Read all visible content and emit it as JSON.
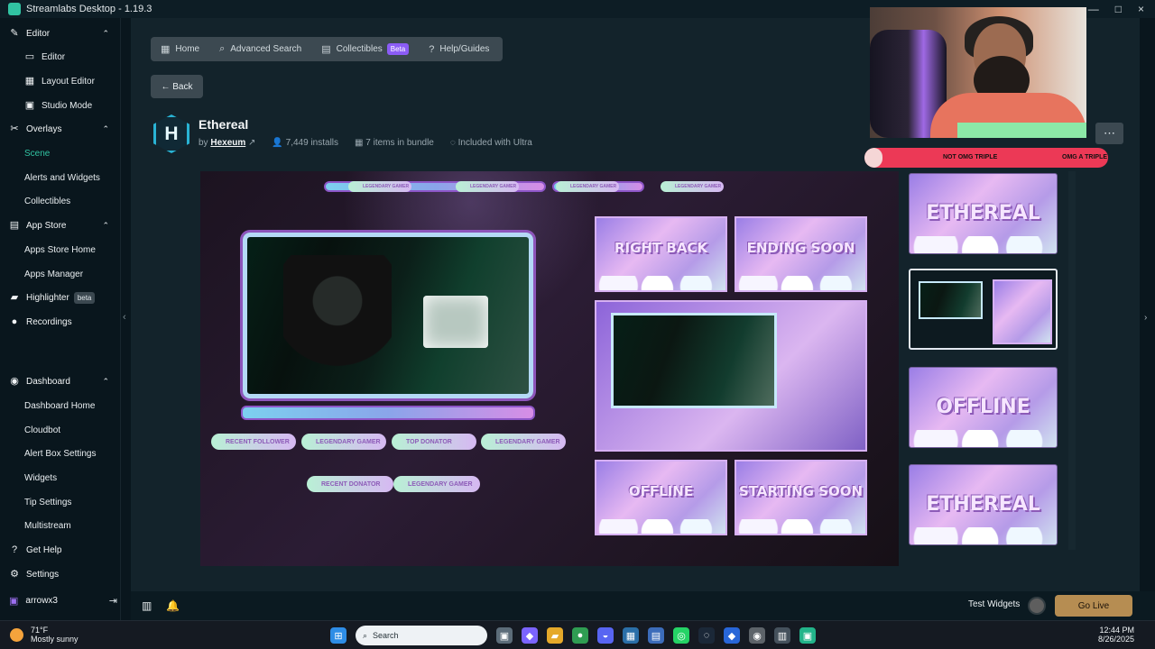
{
  "window": {
    "title": "Streamlabs Desktop - 1.19.3",
    "controls": [
      "—",
      "□",
      "×"
    ]
  },
  "sidebar": {
    "items": [
      {
        "label": "Editor",
        "icon": "pencil-icon",
        "type": "parent"
      },
      {
        "label": "Editor",
        "icon": "monitor-icon",
        "type": "child"
      },
      {
        "label": "Layout Editor",
        "icon": "layout-icon",
        "type": "child"
      },
      {
        "label": "Studio Mode",
        "icon": "studio-icon",
        "type": "child"
      },
      {
        "label": "Overlays",
        "icon": "brush-icon",
        "type": "parent"
      },
      {
        "label": "Scene",
        "icon": "",
        "type": "child",
        "active": true
      },
      {
        "label": "Alerts and Widgets",
        "icon": "",
        "type": "child"
      },
      {
        "label": "Collectibles",
        "icon": "",
        "type": "child"
      },
      {
        "label": "App Store",
        "icon": "store-icon",
        "type": "parent"
      },
      {
        "label": "Apps Store Home",
        "icon": "",
        "type": "child"
      },
      {
        "label": "Apps Manager",
        "icon": "",
        "type": "child"
      },
      {
        "label": "Highlighter",
        "icon": "highlighter-icon",
        "type": "parent",
        "badge": "beta"
      },
      {
        "label": "Recordings",
        "icon": "record-icon",
        "type": "parent"
      },
      {
        "label": "Dashboard",
        "icon": "dashboard-icon",
        "type": "parent"
      },
      {
        "label": "Dashboard Home",
        "icon": "",
        "type": "child"
      },
      {
        "label": "Cloudbot",
        "icon": "",
        "type": "child"
      },
      {
        "label": "Alert Box Settings",
        "icon": "",
        "type": "child"
      },
      {
        "label": "Widgets",
        "icon": "",
        "type": "child"
      },
      {
        "label": "Tip Settings",
        "icon": "",
        "type": "child"
      },
      {
        "label": "Multistream",
        "icon": "",
        "type": "child"
      },
      {
        "label": "Get Help",
        "icon": "help-icon",
        "type": "parent"
      },
      {
        "label": "Settings",
        "icon": "gear-icon",
        "type": "parent"
      }
    ],
    "user": "arrowx3"
  },
  "tabs": [
    {
      "label": "Home",
      "icon": "grid-icon"
    },
    {
      "label": "Advanced Search",
      "icon": "search-icon"
    },
    {
      "label": "Collectibles",
      "icon": "collectibles-icon",
      "badge": "Beta"
    },
    {
      "label": "Help/Guides",
      "icon": "question-icon"
    }
  ],
  "back": "Back",
  "overlay": {
    "logo_letter": "H",
    "title": "Ethereal",
    "by": "by",
    "author": "Hexeum",
    "installs": "7,449 installs",
    "items": "7 items in bundle",
    "ultra": "Included with Ultra"
  },
  "preview": {
    "labels": [
      "LEGENDARY GAMER",
      "LEGENDARY GAMER",
      "LEGENDARY GAMER",
      "LEGENDARY GAMER",
      "RECENT FOLLOWER",
      "LEGENDARY GAMER",
      "TOP DONATOR",
      "LEGENDARY GAMER",
      "RECENT DONATOR",
      "LEGENDARY GAMER"
    ],
    "scenes": [
      "RIGHT BACK",
      "ENDING SOON",
      "OFFLINE",
      "STARTING SOON"
    ]
  },
  "thumbnails": [
    "ETHEREAL",
    "OFFLINE",
    "ETHEREAL"
  ],
  "alert": {
    "left": "NOT OMG TRIPLE",
    "right": "OMG A TRIPLE"
  },
  "bottom": {
    "test_widgets": "Test Widgets",
    "go_live": "Go Live"
  },
  "taskbar": {
    "temp": "71°F",
    "weather": "Mostly sunny",
    "search": "Search",
    "time": "12:44 PM",
    "date": "8/26/2025"
  }
}
